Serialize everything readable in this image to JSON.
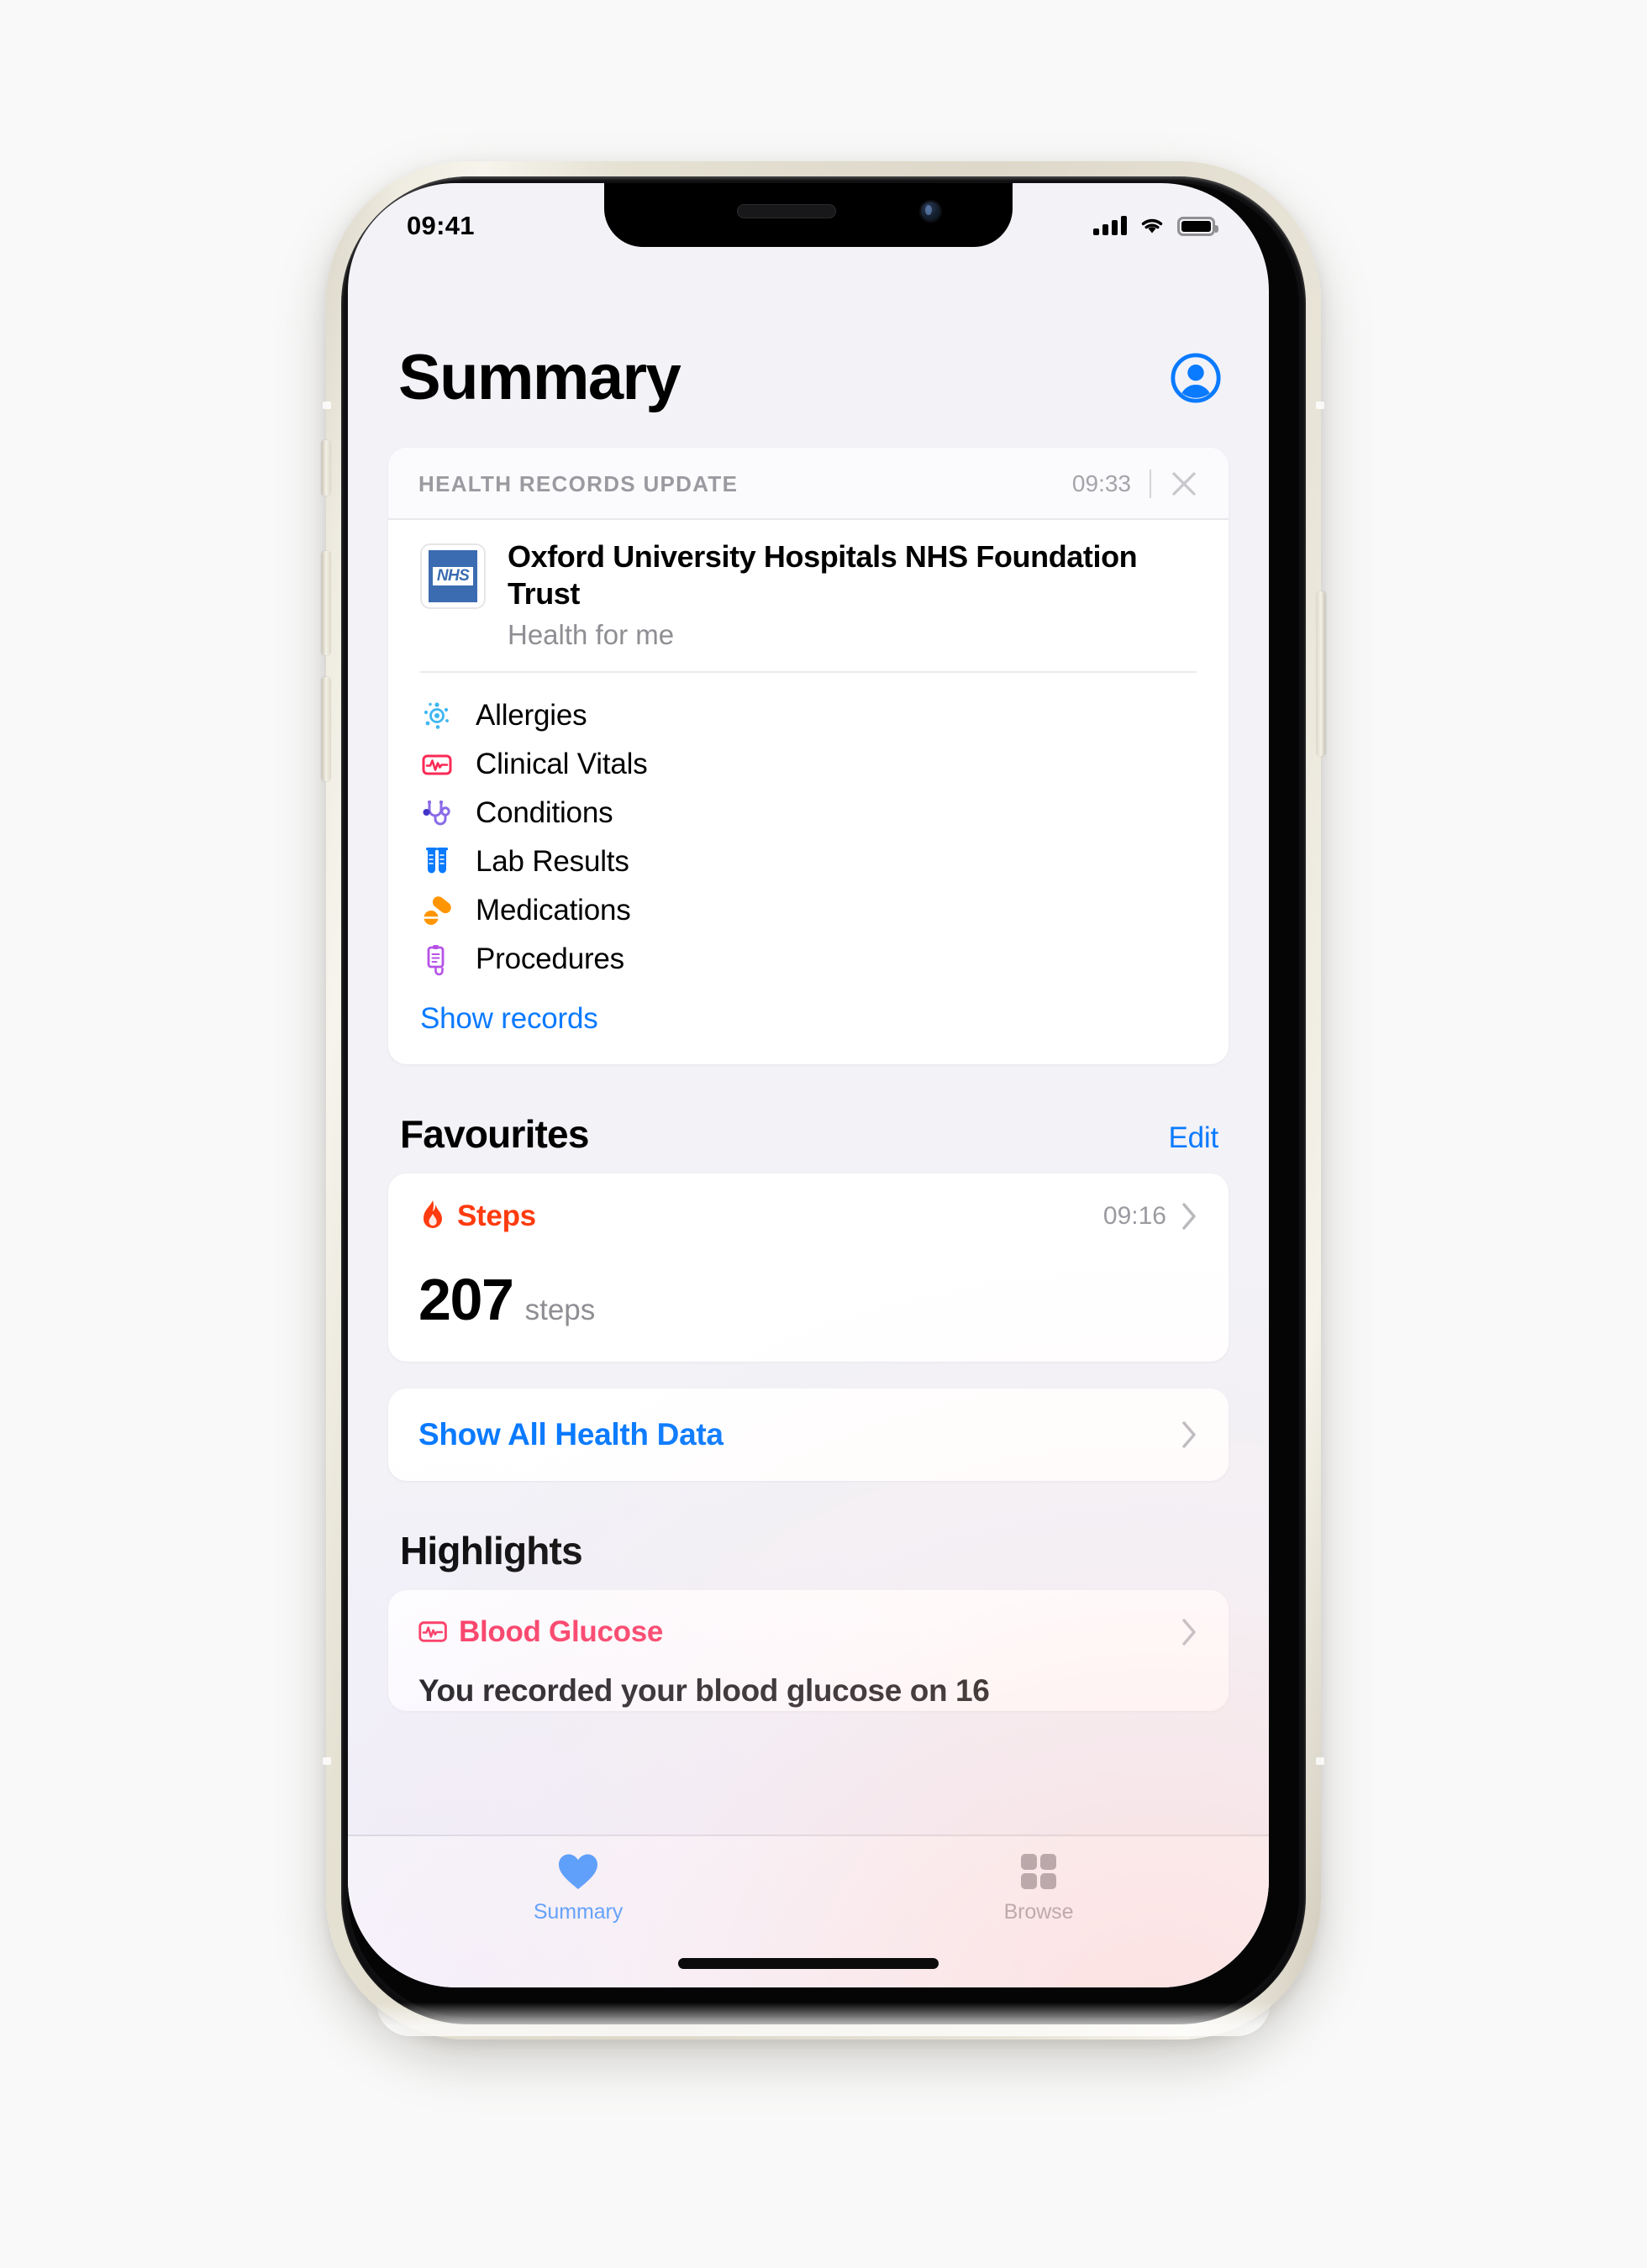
{
  "status_bar": {
    "time": "09:41",
    "signal_icon": "cellular-signal-icon",
    "wifi_icon": "wifi-icon",
    "battery_icon": "battery-icon"
  },
  "header": {
    "title": "Summary",
    "profile_icon": "profile-avatar-icon"
  },
  "health_records_card": {
    "section_label": "HEALTH RECORDS UPDATE",
    "time": "09:33",
    "close_icon": "close-x-icon",
    "org_logo": "nhs-logo",
    "org_logo_text": "NHS",
    "org_name": "Oxford University Hospitals NHS Foundation Trust",
    "org_subtitle": "Health for me",
    "records": [
      {
        "label": "Allergies",
        "icon": "allergies-icon",
        "color": "#3FB6F0"
      },
      {
        "label": "Clinical Vitals",
        "icon": "clinical-vitals-icon",
        "color": "#FB2A55"
      },
      {
        "label": "Conditions",
        "icon": "conditions-icon",
        "color": "#7B5CE0"
      },
      {
        "label": "Lab Results",
        "icon": "lab-results-icon",
        "color": "#0A7AFF"
      },
      {
        "label": "Medications",
        "icon": "medications-icon",
        "color": "#FF9500"
      },
      {
        "label": "Procedures",
        "icon": "procedures-icon",
        "color": "#B652E8"
      }
    ],
    "show_records_link": "Show records"
  },
  "favourites": {
    "title": "Favourites",
    "edit_label": "Edit",
    "steps": {
      "name": "Steps",
      "icon": "flame-icon",
      "time": "09:16",
      "chevron": "chevron-right-icon",
      "value": "207",
      "unit": "steps",
      "color": "#FF3B0F"
    },
    "show_all_label": "Show All Health Data",
    "show_all_chevron": "chevron-right-icon"
  },
  "highlights": {
    "title": "Highlights",
    "items": [
      {
        "name": "Blood Glucose",
        "icon": "clinical-vitals-icon",
        "color": "#FB2A55",
        "chevron": "chevron-right-icon",
        "text": "You recorded your blood glucose on 16"
      }
    ]
  },
  "tab_bar": {
    "tabs": [
      {
        "label": "Summary",
        "icon": "heart-icon",
        "active": true
      },
      {
        "label": "Browse",
        "icon": "grid-icon",
        "active": false
      }
    ]
  },
  "colors": {
    "accent_blue": "#0A7AFF",
    "screen_background": "#F2F2F7",
    "card_background": "#FFFFFF",
    "page_background": "#F9F9F9"
  }
}
